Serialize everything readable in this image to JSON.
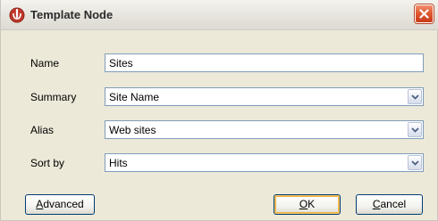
{
  "window": {
    "title": "Template Node"
  },
  "form": {
    "name": {
      "label": "Name",
      "value": "Sites"
    },
    "summary": {
      "label": "Summary",
      "value": "Site Name"
    },
    "alias": {
      "label": "Alias",
      "value": "Web sites"
    },
    "sort_by": {
      "label": "Sort by",
      "value": "Hits"
    }
  },
  "buttons": {
    "advanced": {
      "mnemonic": "A",
      "rest": "dvanced"
    },
    "ok": {
      "mnemonic": "O",
      "rest": "K"
    },
    "cancel": {
      "mnemonic": "C",
      "rest": "ancel"
    }
  },
  "icons": {
    "app": "app-logo-icon",
    "close": "close-icon",
    "dropdown": "chevron-down-icon"
  },
  "colors": {
    "close_button": "#e05a32",
    "app_icon": "#c0392b",
    "input_border": "#7f9db9",
    "default_button_highlight": "#f2b33d",
    "dialog_background": "#ece9d8"
  }
}
